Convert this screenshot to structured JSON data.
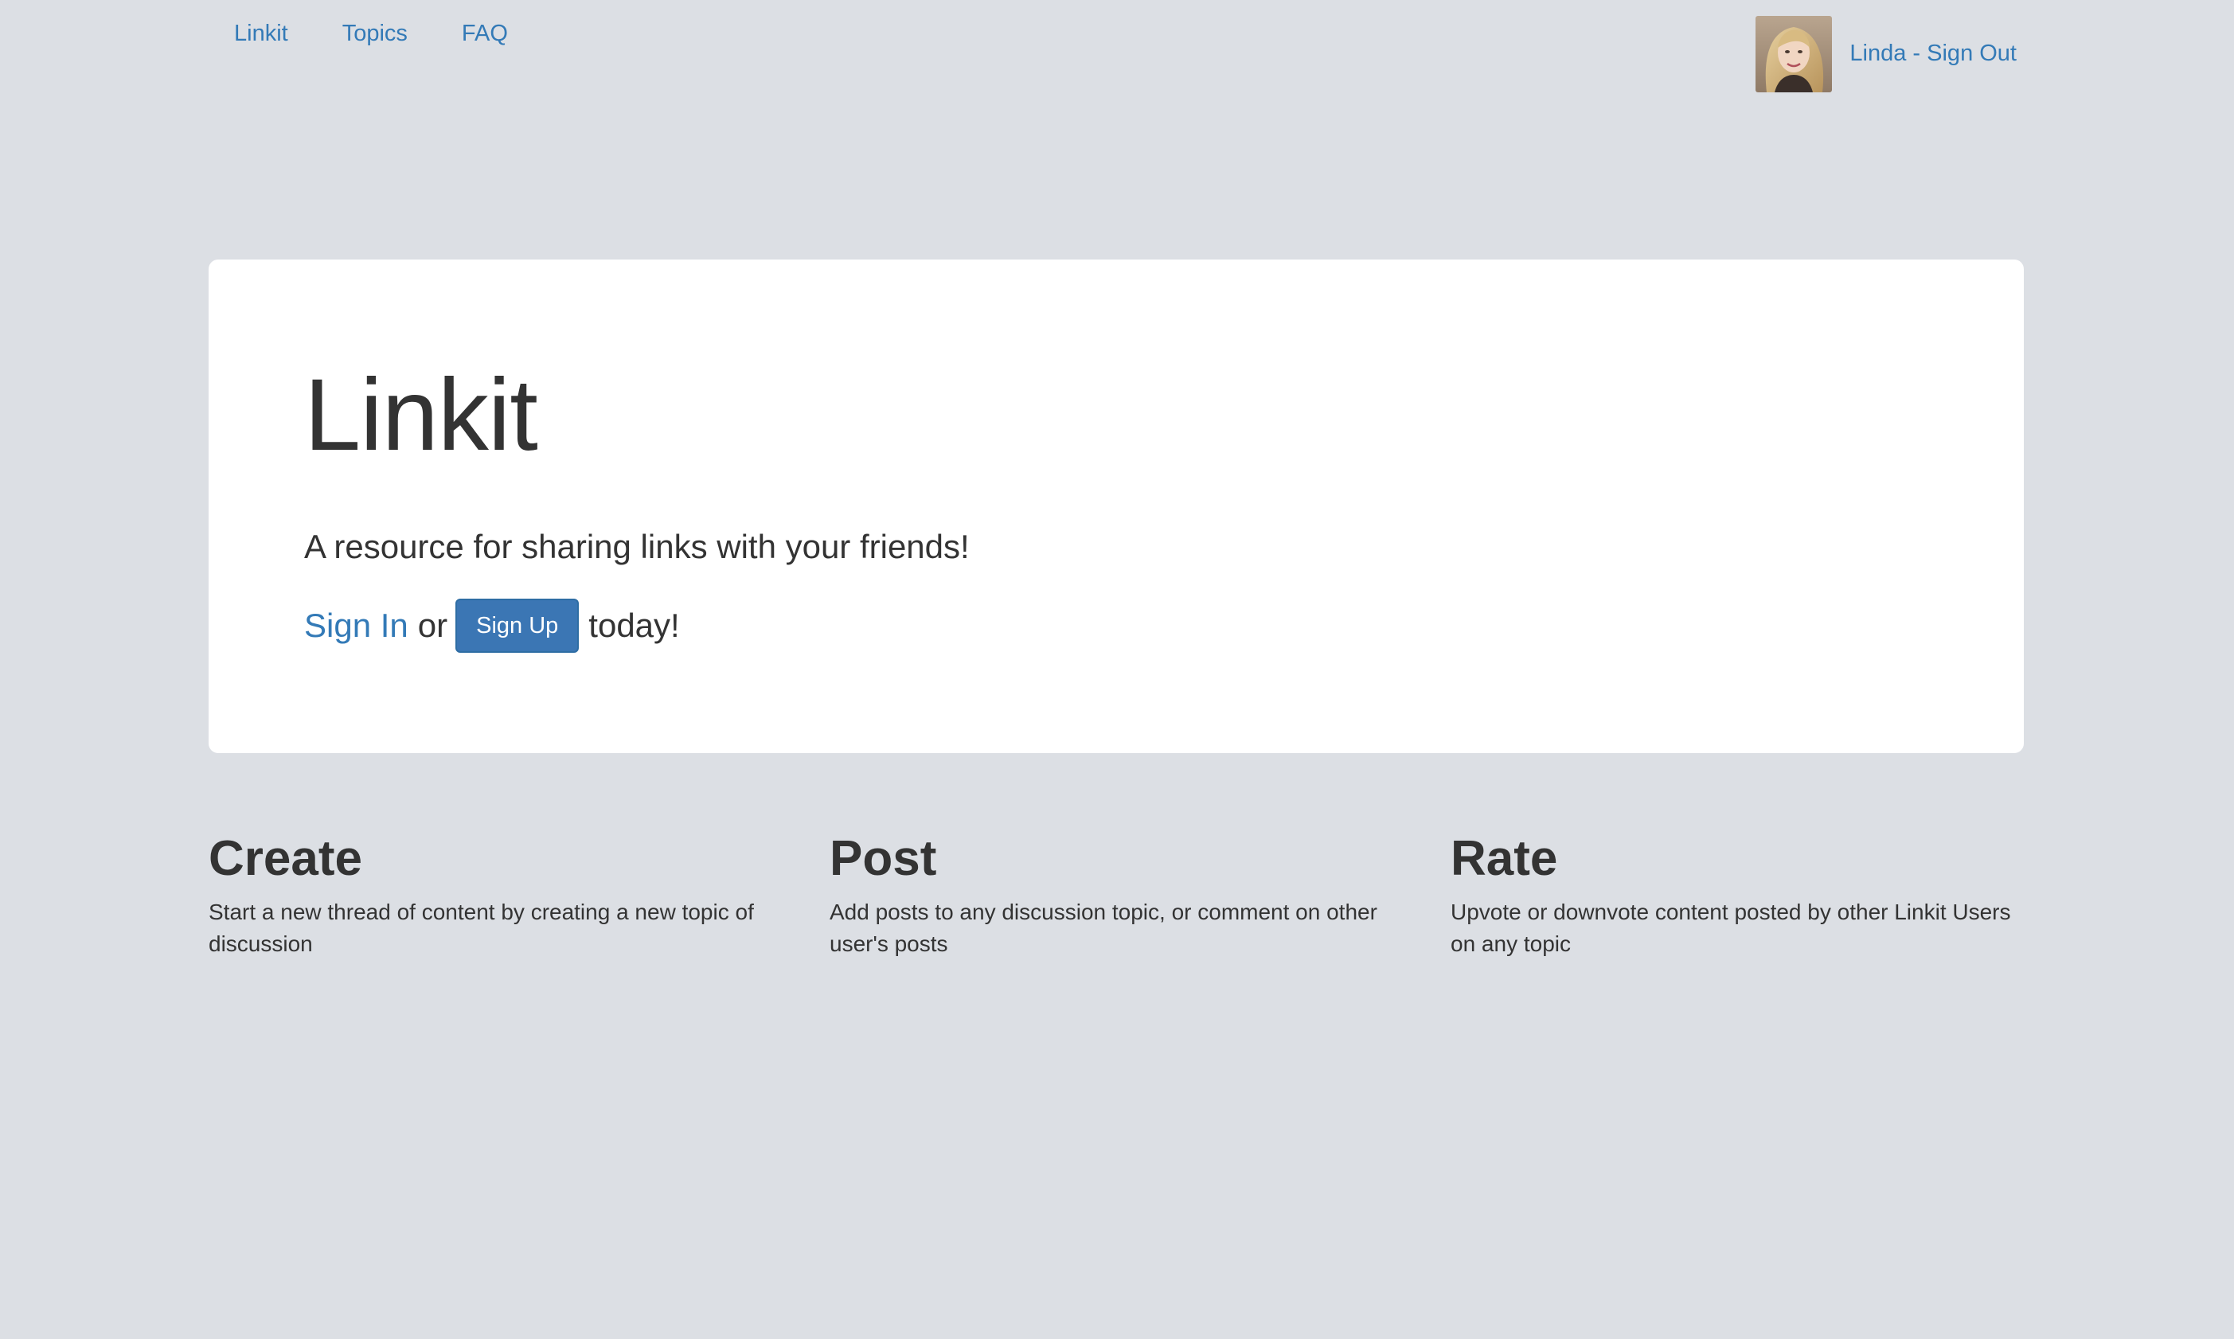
{
  "nav": {
    "links": [
      {
        "label": "Linkit"
      },
      {
        "label": "Topics"
      },
      {
        "label": "FAQ"
      }
    ],
    "user": {
      "signout_label": "Linda - Sign Out",
      "avatar_icon": "user-avatar-photo"
    }
  },
  "hero": {
    "title": "Linkit",
    "tagline": "A resource for sharing links with your friends!",
    "signin_label": "Sign In",
    "or_text": "or",
    "signup_label": "Sign Up",
    "tail_text": "today!"
  },
  "features": [
    {
      "title": "Create",
      "description": "Start a new thread of content by creating a new topic of discussion"
    },
    {
      "title": "Post",
      "description": "Add posts to any discussion topic, or comment on other user's posts"
    },
    {
      "title": "Rate",
      "description": "Upvote or downvote content posted by other Linkit Users on any topic"
    }
  ],
  "colors": {
    "background": "#dcdfe4",
    "link": "#337ab7",
    "primary_button": "#3b76b4",
    "panel": "#ffffff",
    "text": "#333333"
  }
}
